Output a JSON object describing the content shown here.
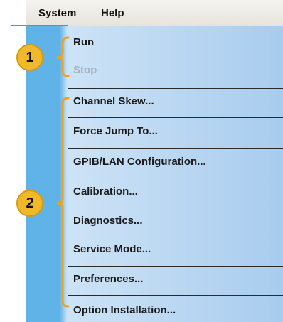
{
  "menubar": {
    "system_label": "System",
    "help_label": "Help"
  },
  "menu": {
    "items": [
      {
        "label": "Run"
      },
      {
        "label": "Stop",
        "disabled": true
      },
      {
        "label": "Channel Skew..."
      },
      {
        "label": "Force Jump To..."
      },
      {
        "label": "GPIB/LAN Configuration..."
      },
      {
        "label": "Calibration..."
      },
      {
        "label": "Diagnostics..."
      },
      {
        "label": "Service Mode..."
      },
      {
        "label": "Preferences..."
      },
      {
        "label": "Option Installation..."
      }
    ]
  },
  "callouts": [
    {
      "label": "1"
    },
    {
      "label": "2"
    }
  ],
  "colors": {
    "callout": "#f0b92c",
    "brace": "#f0a020",
    "menu_strip": "#5fb3e6",
    "menu_bg": "#a8ccee"
  }
}
